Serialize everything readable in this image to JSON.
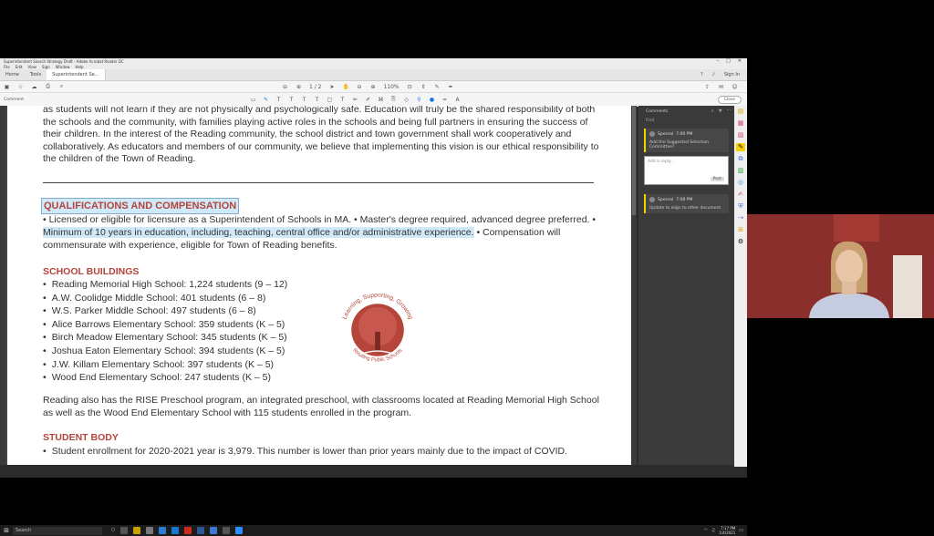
{
  "window": {
    "title": "Superintendent Search Strategy Draft - Adobe Acrobat Reader DC"
  },
  "menu": [
    "File",
    "Edit",
    "View",
    "Sign",
    "Window",
    "Help"
  ],
  "tabs": {
    "home": "Home",
    "tools": "Tools",
    "doc": "Superintendent Se..."
  },
  "header_right": {
    "sign_in": "Sign In"
  },
  "toolbar": {
    "page": "1 / 2",
    "zoom": "110%"
  },
  "comment_bar": {
    "label": "Comment",
    "close": "Close"
  },
  "doc": {
    "intro": "as students will not learn if they are not physically and psychologically safe.  Education will truly be the shared responsibility of both the schools and the community, with families playing active roles in the schools and being full partners in ensuring the success of their children. In the interest of the Reading community, the school district and town government shall work cooperatively and collaboratively. As educators and members of our community, we believe that implementing this vision is our ethical responsibility to the children of the Town of Reading.",
    "qual_heading": "QUALIFICATIONS AND COMPENSATION",
    "qual_a": "•  Licensed or eligible for licensure as a Superintendent of Schools in MA. • Master's degree required, advanced degree preferred. • ",
    "qual_b": "Minimum of 10 years in education, including, teaching, central office and/or administrative experience.",
    "qual_c": " • Compensation will commensurate with experience, eligible for Town of Reading benefits.",
    "buildings_heading": "SCHOOL BUILDINGS",
    "buildings": [
      "Reading Memorial High School: 1,224 students (9 – 12)",
      "A.W. Coolidge Middle School:  401 students (6 – 8)",
      "W.S. Parker Middle School: 497 students (6 – 8)",
      "Alice Barrows Elementary School: 359 students (K – 5)",
      "Birch Meadow Elementary School:  345 students (K – 5)",
      "Joshua Eaton Elementary School:  394 students (K – 5)",
      "J.W. Killam Elementary School:  397 students (K – 5)",
      "Wood End Elementary School:  247 students (K – 5)"
    ],
    "logo_top": "Learning, Supporting, Growing",
    "logo_bottom": "Reading Public Schools",
    "rise": "Reading also has the RISE Preschool program, an integrated preschool, with classrooms located at Reading Memorial High School as well as the Wood End Elementary School with 115 students enrolled in the program.",
    "student_heading": "STUDENT BODY",
    "student_item": "Student enrollment for 2020-2021 year is 3,979. This number is lower than prior years mainly due to the impact of COVID."
  },
  "comments": {
    "title": "Comments",
    "filter": "Find",
    "c1_author": "Spernal",
    "c1_time": "7:06 PM",
    "c1_text": "Add the Suggested Selection Committee?",
    "reply_placeholder": "Add a reply...",
    "post": "Post",
    "c2_author": "Spernal",
    "c2_time": "7:08 PM",
    "c2_text": "Update to align to other document"
  },
  "taskbar": {
    "search": "Search",
    "time": "7:17 PM",
    "date": "1/4/2021"
  },
  "colors": {
    "heading": "#b5443a",
    "highlight": "#cfe9f8",
    "accent": "#f7cf00"
  }
}
